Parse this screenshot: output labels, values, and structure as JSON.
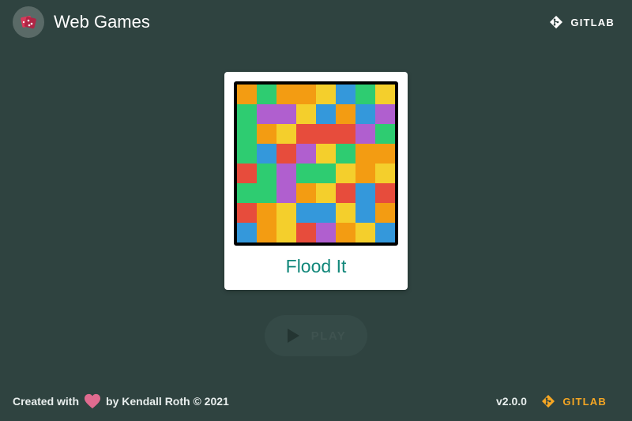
{
  "header": {
    "title": "Web Games",
    "logo_icon": "dice-icon",
    "gitlab_label": "GITLAB",
    "gitlab_icon": "git-icon"
  },
  "game_card": {
    "title": "Flood It",
    "board": {
      "rows": 8,
      "cols": 8,
      "palette": {
        "orange": "#f39c12",
        "green": "#2ecc71",
        "yellow": "#f4cf2c",
        "blue": "#3498db",
        "purple": "#b05fcf",
        "red": "#e74c3c"
      },
      "cells": [
        [
          "orange",
          "green",
          "orange",
          "orange",
          "yellow",
          "blue",
          "green",
          "yellow"
        ],
        [
          "green",
          "purple",
          "purple",
          "yellow",
          "blue",
          "orange",
          "blue",
          "purple"
        ],
        [
          "green",
          "orange",
          "yellow",
          "red",
          "red",
          "red",
          "purple",
          "green"
        ],
        [
          "green",
          "blue",
          "red",
          "purple",
          "yellow",
          "green",
          "orange",
          "orange"
        ],
        [
          "red",
          "green",
          "purple",
          "green",
          "green",
          "yellow",
          "orange",
          "yellow"
        ],
        [
          "green",
          "green",
          "purple",
          "orange",
          "yellow",
          "red",
          "blue",
          "red"
        ],
        [
          "red",
          "orange",
          "yellow",
          "blue",
          "blue",
          "yellow",
          "blue",
          "orange"
        ],
        [
          "blue",
          "orange",
          "yellow",
          "red",
          "purple",
          "orange",
          "yellow",
          "blue"
        ]
      ]
    }
  },
  "play_button": {
    "label": "PLAY",
    "icon": "play-icon",
    "state": "disabled"
  },
  "footer": {
    "created_with": "Created with",
    "heart_icon": "heart-icon",
    "author": "by Kendall Roth © 2021",
    "version": "v2.0.0",
    "gitlab_label": "GITLAB",
    "gitlab_icon": "git-icon"
  },
  "colors": {
    "background": "#2f4340",
    "card_title": "#11877a",
    "accent": "#f5a623",
    "heart": "#e06b8f"
  }
}
